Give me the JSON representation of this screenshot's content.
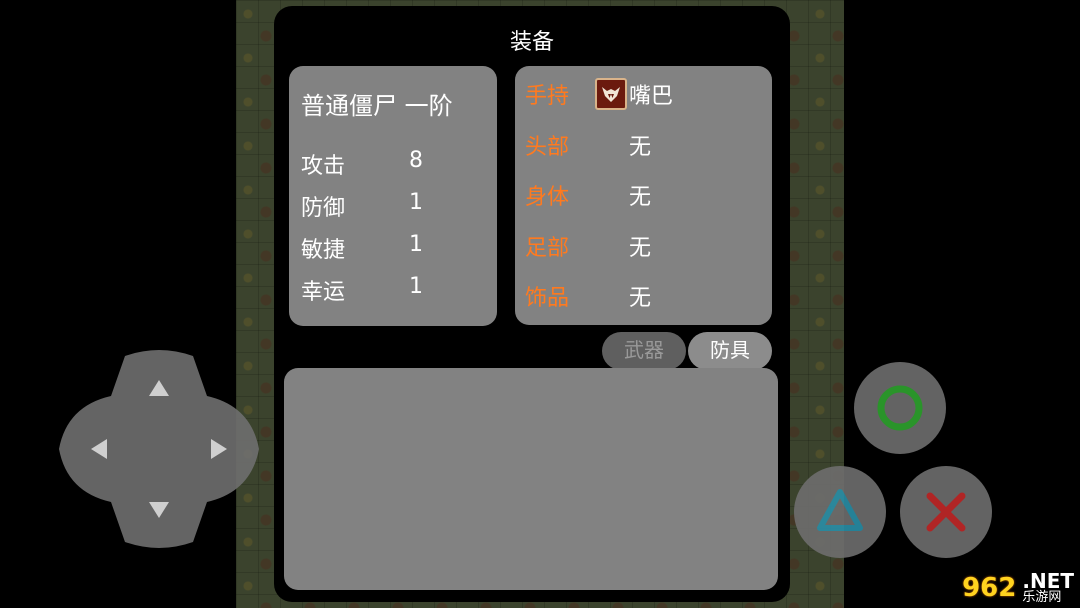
{
  "modal": {
    "title": "装备"
  },
  "monster": {
    "name": "普通僵尸 一阶",
    "stats": [
      {
        "label": "攻击",
        "value": "8"
      },
      {
        "label": "防御",
        "value": "1"
      },
      {
        "label": "敏捷",
        "value": "1"
      },
      {
        "label": "幸运",
        "value": "1"
      }
    ]
  },
  "equipment": {
    "slots": [
      {
        "slot": "手持",
        "item": "嘴巴",
        "icon": "mouth-fangs-icon"
      },
      {
        "slot": "头部",
        "item": "无"
      },
      {
        "slot": "身体",
        "item": "无"
      },
      {
        "slot": "足部",
        "item": "无"
      },
      {
        "slot": "饰品",
        "item": "无"
      }
    ]
  },
  "tabs": {
    "weapon": "武器",
    "armor": "防具",
    "active": "armor"
  },
  "controls": {
    "dpad": [
      "arrow-up-icon",
      "arrow-down-icon",
      "arrow-left-icon",
      "arrow-right-icon"
    ],
    "buttons": [
      {
        "name": "circle",
        "color": "#2fa52f"
      },
      {
        "name": "triangle",
        "color": "#2a8fa8"
      },
      {
        "name": "cross",
        "color": "#c42a2a"
      }
    ]
  },
  "watermark": {
    "part1": "962",
    "part2": ".NET",
    "part3": "乐游网"
  },
  "colors": {
    "slot_label": "#ff7a1f",
    "panel": "#828282",
    "modal": "#000000"
  }
}
